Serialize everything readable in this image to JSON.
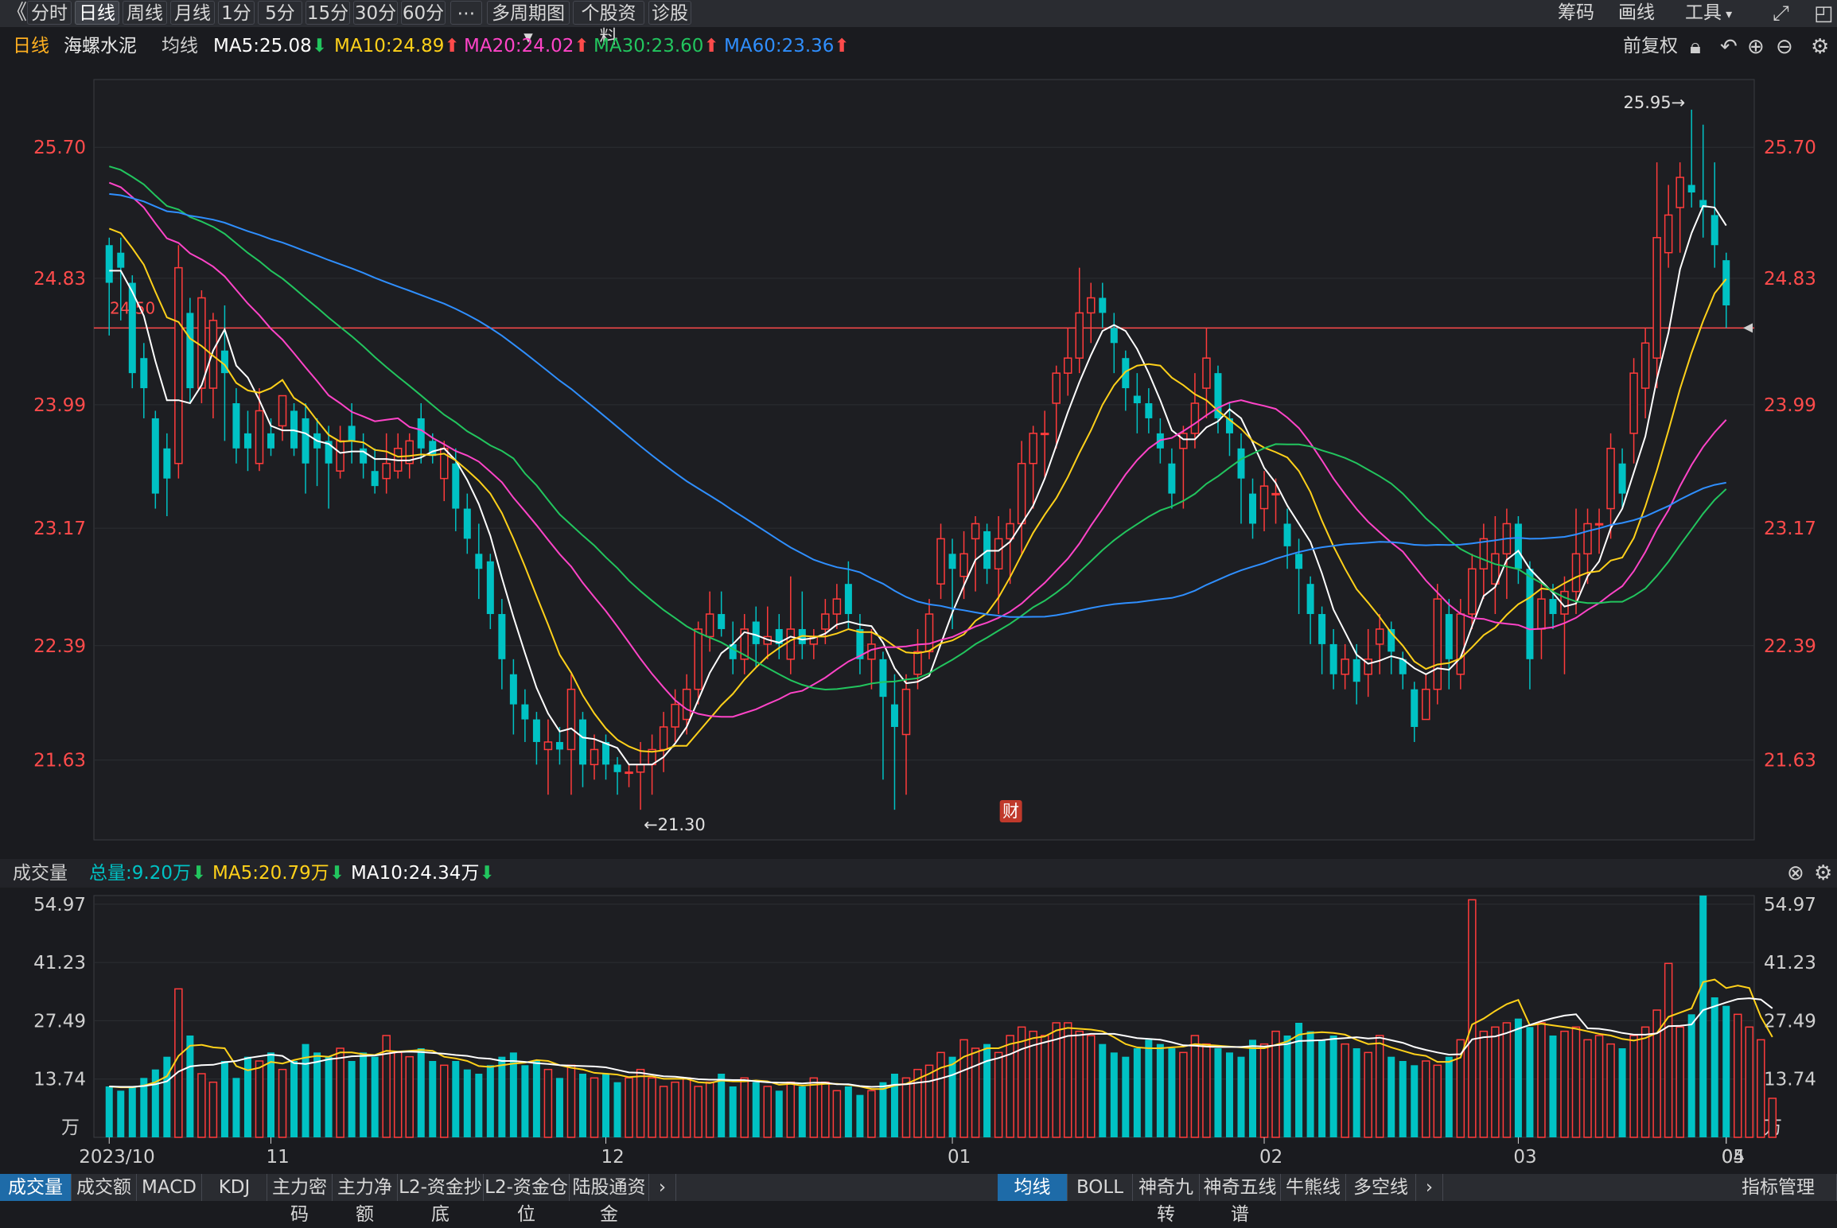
{
  "toolbar": {
    "back_icon": "《",
    "tabs": [
      "分时",
      "日线",
      "周线",
      "月线",
      "1分",
      "5分",
      "15分",
      "30分",
      "60分",
      "⋯",
      "多周期图",
      "个股资料",
      "诊股"
    ],
    "active_tab": "日线",
    "right": [
      "筹码",
      "画线",
      "工具"
    ]
  },
  "legend": {
    "period": "日线",
    "stock": "海螺水泥",
    "ma_label": "均线",
    "ma5": "MA5:25.08",
    "ma10": "MA10:24.89",
    "ma20": "MA20:24.02",
    "ma30": "MA30:23.60",
    "ma60": "MA60:23.36",
    "adjust": "前复权"
  },
  "volume_legend": {
    "label": "成交量",
    "total": "总量:9.20万",
    "ma5": "MA5:20.79万",
    "ma10": "MA10:24.34万"
  },
  "colors": {
    "up": "#ff3b3b",
    "down": "#00c2c4",
    "ma5": "#ffffff",
    "ma10": "#ffd11a",
    "ma20": "#ff44c8",
    "ma30": "#22c55e",
    "ma60": "#2f8fff",
    "price_line": "#ff4b4b"
  },
  "chart_data": [
    {
      "type": "candlestick",
      "y_ticks": [
        "25.70",
        "24.83",
        "23.99",
        "23.17",
        "22.39",
        "21.63"
      ],
      "ylim": [
        21.1,
        26.15
      ],
      "x_ticks": [
        "2023/10",
        "11",
        "12",
        "01",
        "02",
        "03",
        "04",
        "05"
      ],
      "reference_line": {
        "value": 24.5,
        "label": "24.50"
      },
      "annotations": {
        "max": "25.95→",
        "min": "←21.30"
      },
      "marker": "财",
      "candles": [
        [
          25.05,
          24.8,
          25.1,
          24.45
        ],
        [
          25.0,
          24.9,
          25.1,
          24.55
        ],
        [
          24.8,
          24.2,
          24.85,
          24.1
        ],
        [
          24.3,
          24.1,
          24.4,
          23.9
        ],
        [
          23.9,
          23.4,
          23.95,
          23.3
        ],
        [
          23.7,
          23.5,
          23.8,
          23.25
        ],
        [
          23.6,
          24.9,
          25.05,
          23.5
        ],
        [
          24.6,
          24.1,
          24.7,
          24.0
        ],
        [
          24.1,
          24.7,
          24.75,
          24.0
        ],
        [
          24.1,
          24.55,
          24.6,
          23.9
        ],
        [
          24.35,
          24.2,
          24.65,
          23.75
        ],
        [
          24.0,
          23.7,
          24.1,
          23.6
        ],
        [
          23.8,
          23.7,
          23.95,
          23.55
        ],
        [
          23.6,
          23.95,
          24.1,
          23.55
        ],
        [
          23.8,
          23.7,
          23.9,
          23.65
        ],
        [
          23.85,
          24.05,
          24.05,
          23.75
        ],
        [
          23.95,
          23.7,
          24.0,
          23.65
        ],
        [
          23.9,
          23.6,
          24.0,
          23.4
        ],
        [
          23.8,
          23.7,
          23.9,
          23.45
        ],
        [
          23.75,
          23.6,
          23.85,
          23.3
        ],
        [
          23.55,
          23.75,
          23.85,
          23.5
        ],
        [
          23.85,
          23.75,
          24.0,
          23.6
        ],
        [
          23.7,
          23.6,
          23.8,
          23.5
        ],
        [
          23.55,
          23.45,
          23.7,
          23.4
        ],
        [
          23.5,
          23.6,
          23.8,
          23.4
        ],
        [
          23.55,
          23.7,
          23.8,
          23.5
        ],
        [
          23.6,
          23.75,
          23.8,
          23.5
        ],
        [
          23.9,
          23.7,
          24.0,
          23.6
        ],
        [
          23.75,
          23.65,
          23.8,
          23.6
        ],
        [
          23.5,
          23.7,
          23.75,
          23.35
        ],
        [
          23.6,
          23.3,
          23.7,
          23.15
        ],
        [
          23.3,
          23.1,
          23.4,
          23.0
        ],
        [
          23.0,
          22.9,
          23.2,
          22.7
        ],
        [
          22.95,
          22.6,
          23.0,
          22.5
        ],
        [
          22.6,
          22.3,
          22.7,
          22.1
        ],
        [
          22.2,
          22.0,
          22.3,
          21.8
        ],
        [
          22.0,
          21.9,
          22.1,
          21.75
        ],
        [
          21.9,
          21.75,
          21.95,
          21.6
        ],
        [
          21.7,
          21.75,
          21.9,
          21.4
        ],
        [
          21.75,
          21.7,
          21.85,
          21.6
        ],
        [
          21.7,
          22.1,
          22.2,
          21.4
        ],
        [
          21.9,
          21.6,
          21.95,
          21.45
        ],
        [
          21.6,
          21.7,
          21.8,
          21.5
        ],
        [
          21.75,
          21.6,
          21.8,
          21.5
        ],
        [
          21.6,
          21.55,
          21.65,
          21.4
        ],
        [
          21.55,
          21.55,
          21.6,
          21.45
        ],
        [
          21.55,
          21.6,
          21.75,
          21.3
        ],
        [
          21.6,
          21.7,
          21.8,
          21.4
        ],
        [
          21.7,
          21.85,
          21.95,
          21.55
        ],
        [
          21.85,
          22.0,
          22.1,
          21.75
        ],
        [
          21.9,
          22.1,
          22.2,
          21.8
        ],
        [
          22.1,
          22.5,
          22.55,
          22.0
        ],
        [
          22.45,
          22.6,
          22.75,
          22.35
        ],
        [
          22.6,
          22.5,
          22.75,
          22.45
        ],
        [
          22.4,
          22.3,
          22.55,
          22.2
        ],
        [
          22.3,
          22.5,
          22.6,
          22.2
        ],
        [
          22.55,
          22.4,
          22.65,
          22.25
        ],
        [
          22.4,
          22.45,
          22.65,
          22.3
        ],
        [
          22.5,
          22.4,
          22.6,
          22.3
        ],
        [
          22.3,
          22.5,
          22.85,
          22.2
        ],
        [
          22.5,
          22.4,
          22.75,
          22.3
        ],
        [
          22.4,
          22.45,
          22.5,
          22.3
        ],
        [
          22.5,
          22.6,
          22.7,
          22.4
        ],
        [
          22.6,
          22.7,
          22.8,
          22.5
        ],
        [
          22.8,
          22.6,
          22.95,
          22.5
        ],
        [
          22.5,
          22.3,
          22.6,
          22.2
        ],
        [
          22.3,
          22.4,
          22.5,
          22.1
        ],
        [
          22.3,
          22.05,
          22.35,
          21.5
        ],
        [
          22.0,
          21.85,
          22.2,
          21.3
        ],
        [
          21.8,
          22.1,
          22.2,
          21.4
        ],
        [
          22.2,
          22.35,
          22.5,
          22.1
        ],
        [
          22.35,
          22.6,
          22.7,
          22.3
        ],
        [
          22.8,
          23.1,
          23.2,
          22.7
        ],
        [
          23.0,
          22.9,
          23.1,
          22.5
        ],
        [
          22.85,
          23.0,
          23.15,
          22.7
        ],
        [
          23.1,
          23.2,
          23.25,
          22.75
        ],
        [
          23.15,
          22.9,
          23.2,
          22.8
        ],
        [
          22.9,
          23.1,
          23.25,
          22.6
        ],
        [
          23.1,
          23.2,
          23.3,
          22.8
        ],
        [
          23.2,
          23.6,
          23.75,
          23.0
        ],
        [
          23.6,
          23.8,
          23.85,
          23.3
        ],
        [
          23.8,
          23.8,
          23.95,
          23.5
        ],
        [
          24.0,
          24.2,
          24.25,
          23.7
        ],
        [
          24.2,
          24.3,
          24.5,
          24.05
        ],
        [
          24.3,
          24.6,
          24.9,
          24.2
        ],
        [
          24.6,
          24.7,
          24.8,
          24.4
        ],
        [
          24.7,
          24.6,
          24.8,
          24.5
        ],
        [
          24.5,
          24.4,
          24.6,
          24.2
        ],
        [
          24.3,
          24.1,
          24.35,
          23.95
        ],
        [
          24.05,
          24.0,
          24.2,
          23.8
        ],
        [
          24.0,
          23.9,
          24.1,
          23.8
        ],
        [
          23.8,
          23.7,
          23.9,
          23.6
        ],
        [
          23.6,
          23.4,
          23.7,
          23.3
        ],
        [
          23.7,
          23.8,
          23.85,
          23.3
        ],
        [
          23.8,
          24.0,
          24.2,
          23.7
        ],
        [
          24.1,
          24.3,
          24.5,
          23.9
        ],
        [
          24.2,
          23.9,
          24.25,
          23.8
        ],
        [
          23.9,
          23.8,
          24.0,
          23.65
        ],
        [
          23.7,
          23.5,
          23.8,
          23.2
        ],
        [
          23.4,
          23.2,
          23.5,
          23.1
        ],
        [
          23.3,
          23.45,
          23.55,
          23.15
        ],
        [
          23.4,
          23.4,
          23.5,
          23.2
        ],
        [
          23.2,
          23.05,
          23.3,
          22.9
        ],
        [
          23.0,
          22.9,
          23.1,
          22.6
        ],
        [
          22.8,
          22.6,
          22.85,
          22.4
        ],
        [
          22.6,
          22.4,
          22.65,
          22.2
        ],
        [
          22.4,
          22.2,
          22.5,
          22.1
        ],
        [
          22.2,
          22.3,
          22.4,
          22.1
        ],
        [
          22.3,
          22.15,
          22.4,
          22.0
        ],
        [
          22.2,
          22.3,
          22.5,
          22.05
        ],
        [
          22.4,
          22.5,
          22.6,
          22.2
        ],
        [
          22.5,
          22.35,
          22.55,
          22.2
        ],
        [
          22.3,
          22.2,
          22.35,
          22.1
        ],
        [
          22.1,
          21.85,
          22.15,
          21.75
        ],
        [
          21.9,
          22.1,
          22.2,
          21.9
        ],
        [
          22.1,
          22.7,
          22.8,
          22.0
        ],
        [
          22.6,
          22.3,
          22.7,
          22.1
        ],
        [
          22.2,
          22.6,
          22.7,
          22.1
        ],
        [
          22.6,
          22.9,
          23.0,
          22.5
        ],
        [
          22.9,
          23.1,
          23.2,
          22.7
        ],
        [
          22.8,
          23.0,
          23.25,
          22.6
        ],
        [
          23.0,
          23.2,
          23.3,
          22.7
        ],
        [
          23.2,
          22.9,
          23.25,
          22.8
        ],
        [
          22.9,
          22.3,
          22.95,
          22.1
        ],
        [
          22.5,
          22.7,
          22.8,
          22.3
        ],
        [
          22.7,
          22.6,
          22.8,
          22.5
        ],
        [
          22.6,
          22.75,
          22.85,
          22.2
        ],
        [
          22.75,
          23.0,
          23.3,
          22.6
        ],
        [
          23.0,
          23.2,
          23.3,
          22.8
        ],
        [
          23.2,
          23.2,
          23.3,
          23.0
        ],
        [
          23.3,
          23.7,
          23.8,
          23.1
        ],
        [
          23.6,
          23.4,
          23.7,
          23.3
        ],
        [
          23.8,
          24.2,
          24.3,
          23.6
        ],
        [
          24.1,
          24.4,
          24.5,
          23.9
        ],
        [
          24.3,
          25.1,
          25.6,
          24.1
        ],
        [
          25.0,
          25.25,
          25.45,
          24.9
        ],
        [
          25.3,
          25.5,
          25.6,
          25.0
        ],
        [
          25.45,
          25.4,
          25.95,
          25.3
        ],
        [
          25.35,
          25.3,
          25.85,
          25.1
        ],
        [
          25.25,
          25.05,
          25.6,
          24.9
        ],
        [
          24.95,
          24.65,
          25.0,
          24.5
        ]
      ]
    },
    {
      "type": "bar",
      "name": "成交量",
      "unit": "万",
      "y_ticks": [
        "54.97",
        "41.23",
        "27.49",
        "13.74"
      ],
      "ylim": [
        0,
        57
      ],
      "values": [
        12,
        11,
        12,
        14,
        16,
        19,
        35,
        24,
        15,
        13,
        18,
        14,
        19,
        18,
        20,
        16,
        18,
        22,
        20,
        19,
        21,
        18,
        20,
        19,
        24,
        20,
        19,
        21,
        18,
        17,
        18,
        16,
        15,
        17,
        19,
        20,
        17,
        18,
        16,
        14,
        17,
        15,
        14,
        15,
        13,
        14,
        16,
        14,
        12,
        13,
        14,
        12,
        13,
        15,
        12,
        14,
        13,
        12,
        11,
        13,
        12,
        14,
        13,
        11,
        12,
        10,
        11,
        13,
        15,
        14,
        16,
        17,
        20,
        19,
        23,
        21,
        22,
        20,
        24,
        26,
        25,
        24,
        27,
        27,
        25,
        24,
        22,
        20,
        19,
        21,
        23,
        22,
        21,
        20,
        24,
        22,
        21,
        20,
        19,
        23,
        22,
        25,
        24,
        27,
        25,
        23,
        24,
        22,
        21,
        20,
        24,
        19,
        18,
        17,
        18,
        17,
        19,
        23,
        56,
        25,
        26,
        27,
        28,
        26,
        27,
        24,
        25,
        26,
        23,
        24,
        22,
        21,
        24,
        26,
        30,
        41,
        26,
        29,
        57,
        33,
        31,
        29,
        26,
        23,
        9.2
      ],
      "ma5_line_color": "#ffd11a",
      "ma10_line_color": "#ffffff"
    }
  ]
}
